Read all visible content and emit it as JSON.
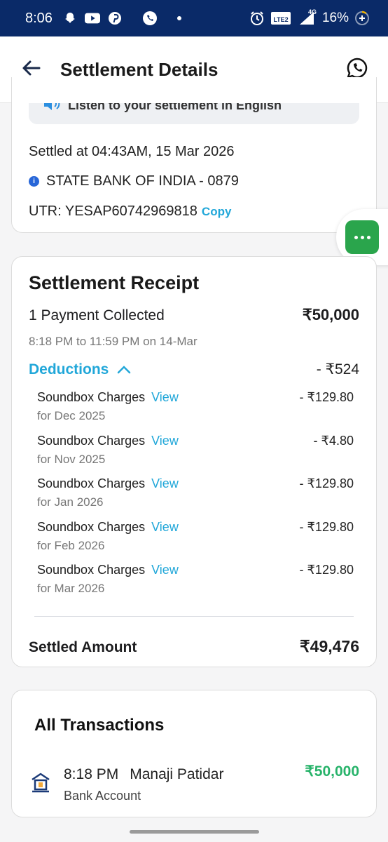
{
  "status_bar": {
    "time": "8:06",
    "network": "4G",
    "lte_label": "LTE2",
    "battery": "16%",
    "icons": [
      "snapchat-icon",
      "youtube-icon",
      "pinterest-icon",
      "phone-app-icon",
      "dot-icon",
      "alarm-icon",
      "volte-icon",
      "signal-icon",
      "battery-icon"
    ]
  },
  "header": {
    "title": "Settlement Details",
    "back_icon": "arrow-left-icon",
    "help_icon": "whatsapp-icon"
  },
  "settlement_info": {
    "listen_text": "Listen to your settlement in English",
    "settled_at": "Settled at 04:43AM, 15 Mar 2026",
    "bank": "STATE BANK OF INDIA - 0879",
    "utr": "UTR: YESAP60742969818",
    "copy_label": "Copy"
  },
  "receipt": {
    "title": "Settlement Receipt",
    "payment_label": "1 Payment Collected",
    "payment_amount": "₹50,000",
    "time_range": "8:18 PM to 11:59 PM on 14-Mar",
    "deductions_label": "Deductions",
    "deductions_total": "- ₹524",
    "charges": [
      {
        "label": "Soundbox Charges",
        "view": "View",
        "period": "for Dec 2025",
        "amount": "- ₹129.80"
      },
      {
        "label": "Soundbox Charges",
        "view": "View",
        "period": "for Nov 2025",
        "amount": "- ₹4.80"
      },
      {
        "label": "Soundbox Charges",
        "view": "View",
        "period": "for Jan 2026",
        "amount": "- ₹129.80"
      },
      {
        "label": "Soundbox Charges",
        "view": "View",
        "period": "for Feb 2026",
        "amount": "- ₹129.80"
      },
      {
        "label": "Soundbox Charges",
        "view": "View",
        "period": "for Mar 2026",
        "amount": "- ₹129.80"
      }
    ],
    "settled_label": "Settled Amount",
    "settled_amount": "₹49,476"
  },
  "transactions": {
    "title": "All Transactions",
    "items": [
      {
        "time": "8:18 PM",
        "name": "Manaji Patidar",
        "method": "Bank Account",
        "amount": "₹50,000"
      }
    ]
  },
  "colors": {
    "status_bar": "#0a2a68",
    "accent": "#21a7d9",
    "success": "#27b36a",
    "float_button": "#2aa54c"
  }
}
